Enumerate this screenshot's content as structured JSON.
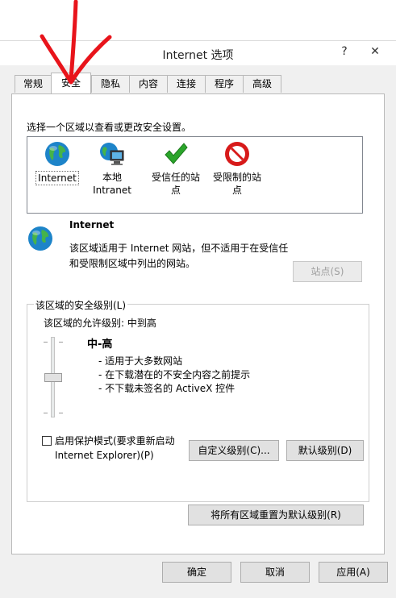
{
  "window": {
    "title": "Internet 选项",
    "help_glyph": "?",
    "close_glyph": "✕"
  },
  "tabs": [
    {
      "label": "常规"
    },
    {
      "label": "安全",
      "active": true
    },
    {
      "label": "隐私"
    },
    {
      "label": "内容"
    },
    {
      "label": "连接"
    },
    {
      "label": "程序"
    },
    {
      "label": "高级"
    }
  ],
  "security": {
    "heading": "选择一个区域以查看或更改安全设置。",
    "zones": [
      {
        "label": "Internet",
        "icon": "globe-icon"
      },
      {
        "label": "本地\nIntranet",
        "icon": "intranet-icon"
      },
      {
        "label": "受信任的站\n点",
        "icon": "checkmark-icon"
      },
      {
        "label": "受限制的站\n点",
        "icon": "no-entry-icon"
      }
    ],
    "selected_zone": {
      "title": "Internet",
      "description": "该区域适用于 Internet 网站，但不适用于在受信任和受限制区域中列出的网站。",
      "sites_button": "站点(S)"
    },
    "level": {
      "group_label": "该区域的安全级别(L)",
      "allowed": "该区域的允许级别: 中到高",
      "name": "中-高",
      "bullets": [
        "- 适用于大多数网站",
        "- 在下载潜在的不安全内容之前提示",
        "- 不下载未签名的 ActiveX 控件"
      ],
      "slider_position_fraction": 0.5,
      "protected_mode_label": "启用保护模式(要求重新启动 Internet Explorer)(P)",
      "protected_mode_checked": false,
      "custom_button": "自定义级别(C)...",
      "default_button": "默认级别(D)"
    },
    "reset_all_button": "将所有区域重置为默认级别(R)"
  },
  "footer": {
    "ok": "确定",
    "cancel": "取消",
    "apply": "应用(A)"
  },
  "colors": {
    "annotation_arrow": "#e8141b",
    "globe": "#1d84c9",
    "check": "#2aa52a",
    "restricted": "#d71a1a"
  }
}
